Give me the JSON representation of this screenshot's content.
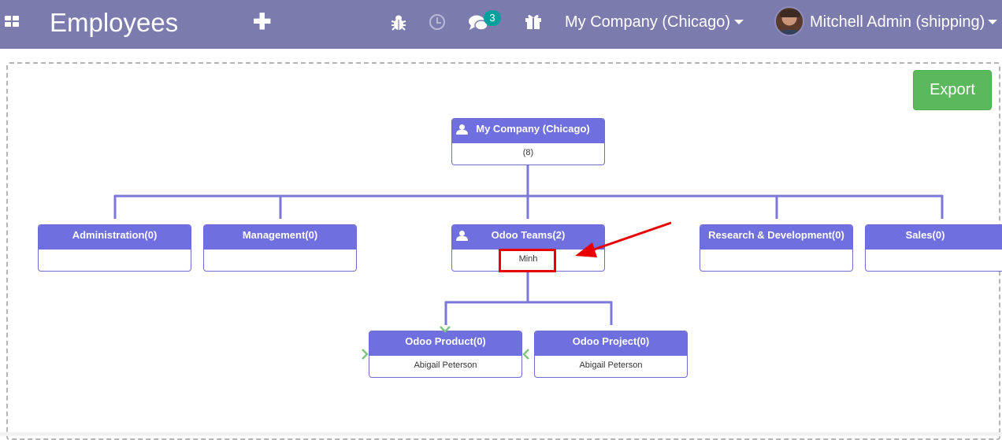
{
  "navbar": {
    "app_title": "Employees",
    "plus_label": "✚",
    "icons": [
      "apps-icon",
      "plus-icon",
      "bug-icon",
      "clock-icon",
      "chat-icon",
      "gift-icon"
    ],
    "messages_count": "3",
    "company": "My Company (Chicago)",
    "user": "Mitchell Admin (shipping)",
    "background_color": "#7c7bad",
    "badge_color": "#00a09d"
  },
  "export_button": {
    "label": "Export",
    "color": "#5cb85c"
  },
  "org_chart": {
    "root": {
      "title": "My Company (Chicago)",
      "content": "(8)"
    },
    "departments": [
      {
        "title": "Administration(0)",
        "content": ""
      },
      {
        "title": "Management(0)",
        "content": ""
      },
      {
        "title": "Odoo Teams(2)",
        "content": "Minh"
      },
      {
        "title": "Research & Development(0)",
        "content": ""
      },
      {
        "title": "Sales(0)",
        "content": ""
      }
    ],
    "sub_teams": [
      {
        "title": "Odoo Product(0)",
        "content": "Abigail Peterson"
      },
      {
        "title": "Odoo Project(0)",
        "content": "Abigail Peterson"
      }
    ],
    "node_header_color": "#6f6fe0",
    "highlight_color": "#e80000"
  }
}
